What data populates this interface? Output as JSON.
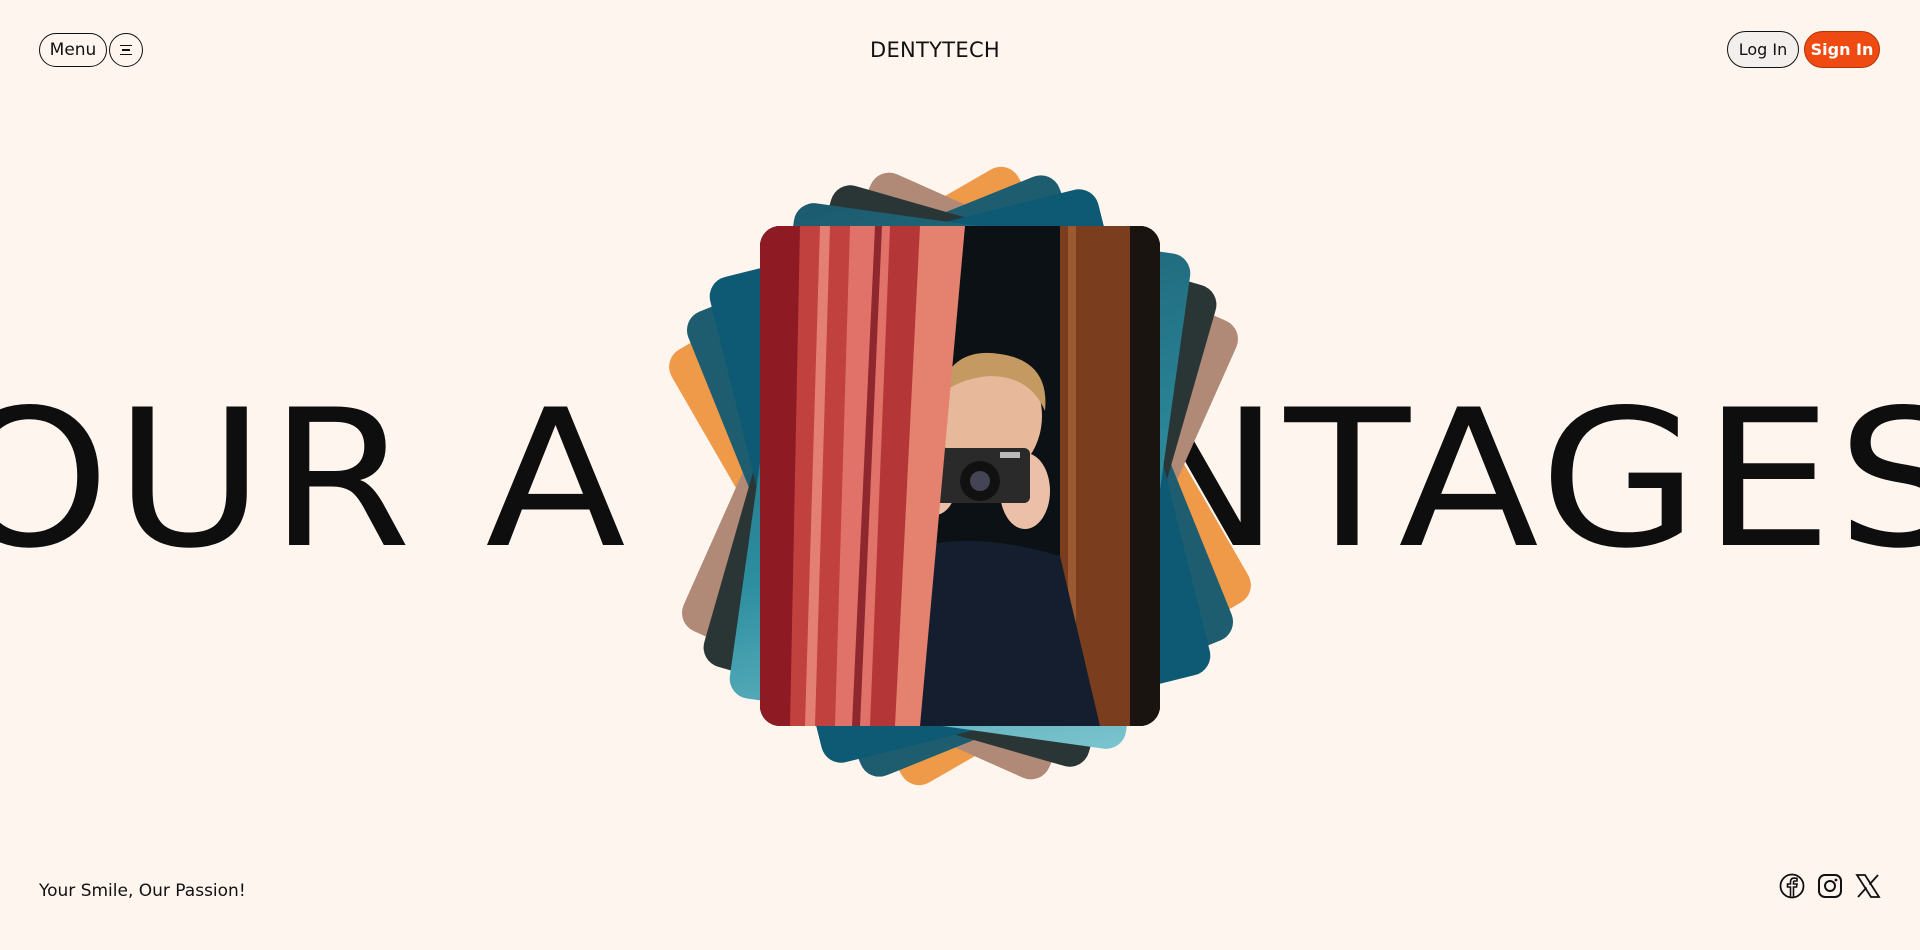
{
  "header": {
    "menu_label": "Menu",
    "menu_icon": "hamburger-icon",
    "brand": "DENTYTECH",
    "login_label": "Log In",
    "signin_label": "Sign In"
  },
  "hero": {
    "title": "OUR ADVANTAGES",
    "visible_title_left": "OUR A",
    "visible_title_right": "NTAGES"
  },
  "footer": {
    "tagline": "Your Smile, Our Passion!",
    "social_icons": [
      "facebook-icon",
      "instagram-icon",
      "x-icon"
    ]
  },
  "colors": {
    "background": "#fff5ef",
    "accent": "#ef4a12",
    "text": "#111111"
  }
}
